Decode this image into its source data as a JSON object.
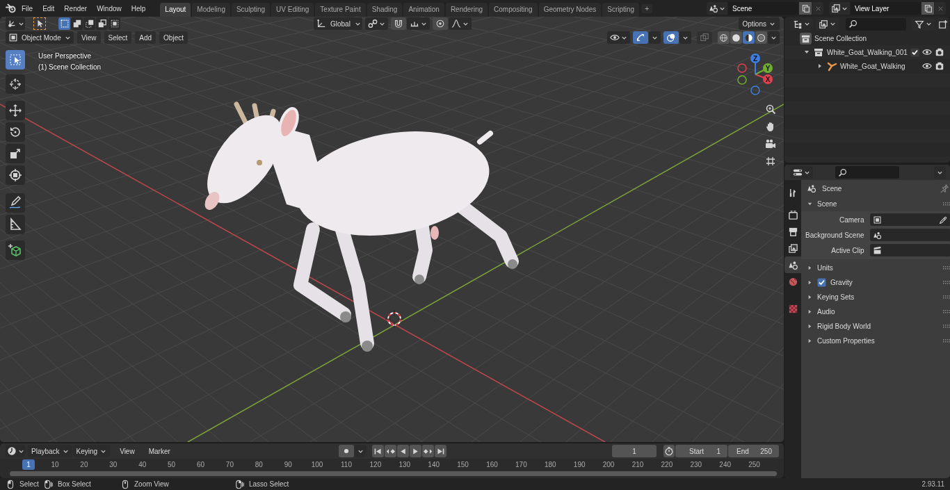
{
  "top_bar": {
    "menus": [
      "File",
      "Edit",
      "Render",
      "Window",
      "Help"
    ],
    "workspaces": [
      {
        "label": "Layout",
        "selected": true
      },
      {
        "label": "Modeling",
        "selected": false
      },
      {
        "label": "Sculpting",
        "selected": false
      },
      {
        "label": "UV Editing",
        "selected": false
      },
      {
        "label": "Texture Paint",
        "selected": false
      },
      {
        "label": "Shading",
        "selected": false
      },
      {
        "label": "Animation",
        "selected": false
      },
      {
        "label": "Rendering",
        "selected": false
      },
      {
        "label": "Compositing",
        "selected": false
      },
      {
        "label": "Geometry Nodes",
        "selected": false
      },
      {
        "label": "Scripting",
        "selected": false
      }
    ],
    "add_workspace": "+",
    "scene": "Scene",
    "view_layer": "View Layer"
  },
  "viewport": {
    "select_modes": [
      {
        "selected": true
      },
      {
        "selected": false
      },
      {
        "selected": false
      },
      {
        "selected": false
      },
      {
        "selected": false
      }
    ],
    "orientation": "Global",
    "options": "Options",
    "mode": "Object Mode",
    "menus": [
      "View",
      "Select",
      "Add",
      "Object"
    ],
    "gizmos_on": true,
    "overlays_on": true,
    "xray": false,
    "shading_modes": [
      {
        "selected": false
      },
      {
        "selected": false
      },
      {
        "selected": true
      },
      {
        "selected": false
      }
    ],
    "info": [
      "User Perspective",
      "(1) Scene Collection"
    ],
    "tools": [
      {
        "selected": true
      },
      {
        "selected": false
      },
      {
        "selected": false
      },
      {
        "selected": false
      },
      {
        "selected": false
      },
      {
        "selected": false
      },
      {
        "selected": false
      },
      {
        "selected": false
      },
      {
        "selected": false
      }
    ],
    "gizmo_axes": [
      "X",
      "Y",
      "Z"
    ]
  },
  "outliner": {
    "items": [
      {
        "label": "Scene Collection",
        "kind": "scene_collection",
        "children": [
          {
            "label": "White_Goat_Walking_001",
            "kind": "collection",
            "expanded": true,
            "checked": true,
            "children": [
              {
                "label": "White_Goat_Walking",
                "kind": "armature",
                "expanded": false
              }
            ]
          }
        ]
      }
    ]
  },
  "properties": {
    "tabs": [
      {
        "selected": false
      },
      {
        "selected": false
      },
      {
        "selected": false
      },
      {
        "selected": false
      },
      {
        "selected": true
      },
      {
        "selected": false
      },
      {
        "selected": false
      }
    ],
    "context": "Scene",
    "panels": [
      {
        "title": "Scene",
        "expanded": true,
        "fields": [
          {
            "label": "Camera",
            "kind": "camera"
          },
          {
            "label": "Background Scene",
            "kind": "scene"
          },
          {
            "label": "Active Clip",
            "kind": "clip"
          }
        ]
      },
      {
        "title": "Units",
        "expanded": false
      },
      {
        "title": "Gravity",
        "expanded": false,
        "checked": true
      },
      {
        "title": "Keying Sets",
        "expanded": false
      },
      {
        "title": "Audio",
        "expanded": false
      },
      {
        "title": "Rigid Body World",
        "expanded": false
      },
      {
        "title": "Custom Properties",
        "expanded": false
      }
    ]
  },
  "timeline": {
    "menus": [
      "Playback",
      "Keying",
      "View",
      "Marker"
    ],
    "current_frame": "1",
    "start": {
      "label": "Start",
      "value": "1"
    },
    "end": {
      "label": "End",
      "value": "250"
    },
    "playhead": "1",
    "ruler": [
      "10",
      "20",
      "30",
      "40",
      "50",
      "60",
      "70",
      "80",
      "90",
      "100",
      "110",
      "120",
      "130",
      "140",
      "150",
      "160",
      "170",
      "180",
      "190",
      "200",
      "210",
      "220",
      "230",
      "240",
      "250"
    ]
  },
  "status_bar": {
    "hints": [
      "Select",
      "Box Select",
      "Zoom View",
      "Lasso Select"
    ],
    "version": "2.93.11"
  }
}
